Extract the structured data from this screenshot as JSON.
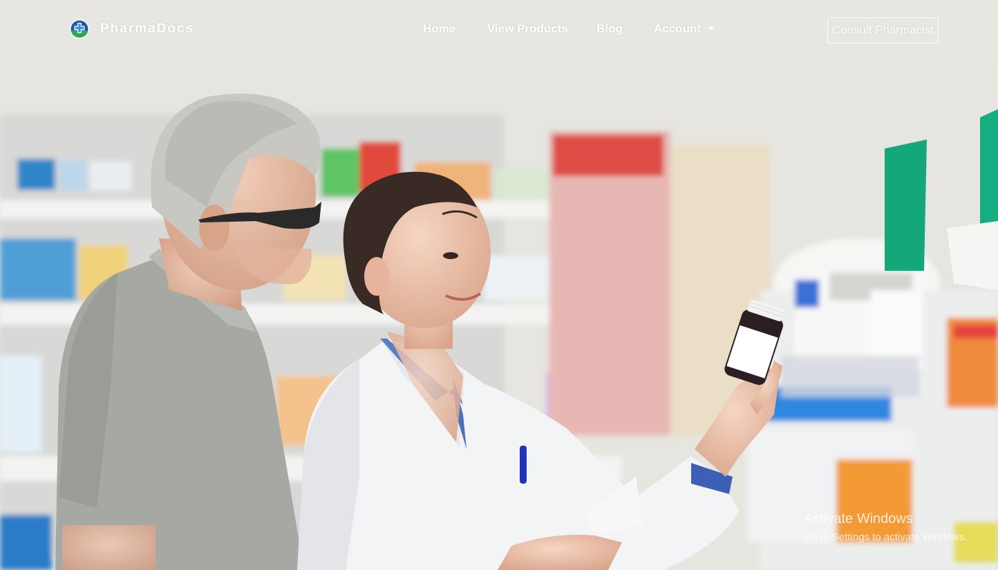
{
  "brand": {
    "name": "PharmaDocs",
    "logo_icon": "medical-cross-globe-icon"
  },
  "nav": {
    "home": "Home",
    "products": "View Products",
    "blog": "Blog",
    "account": "Account"
  },
  "cta": {
    "consult_label": "Consult Pharmacist"
  },
  "hero": {
    "image": "pharmacist-with-customer-photo"
  },
  "watermark": {
    "title": "Activate Windows",
    "subtitle": "Go to Settings to activate Windows."
  },
  "colors": {
    "nav_text": "#ffffff",
    "logo_blue": "#1f5aa6",
    "logo_green": "#2fa84f",
    "wall": "#e6e5df"
  }
}
